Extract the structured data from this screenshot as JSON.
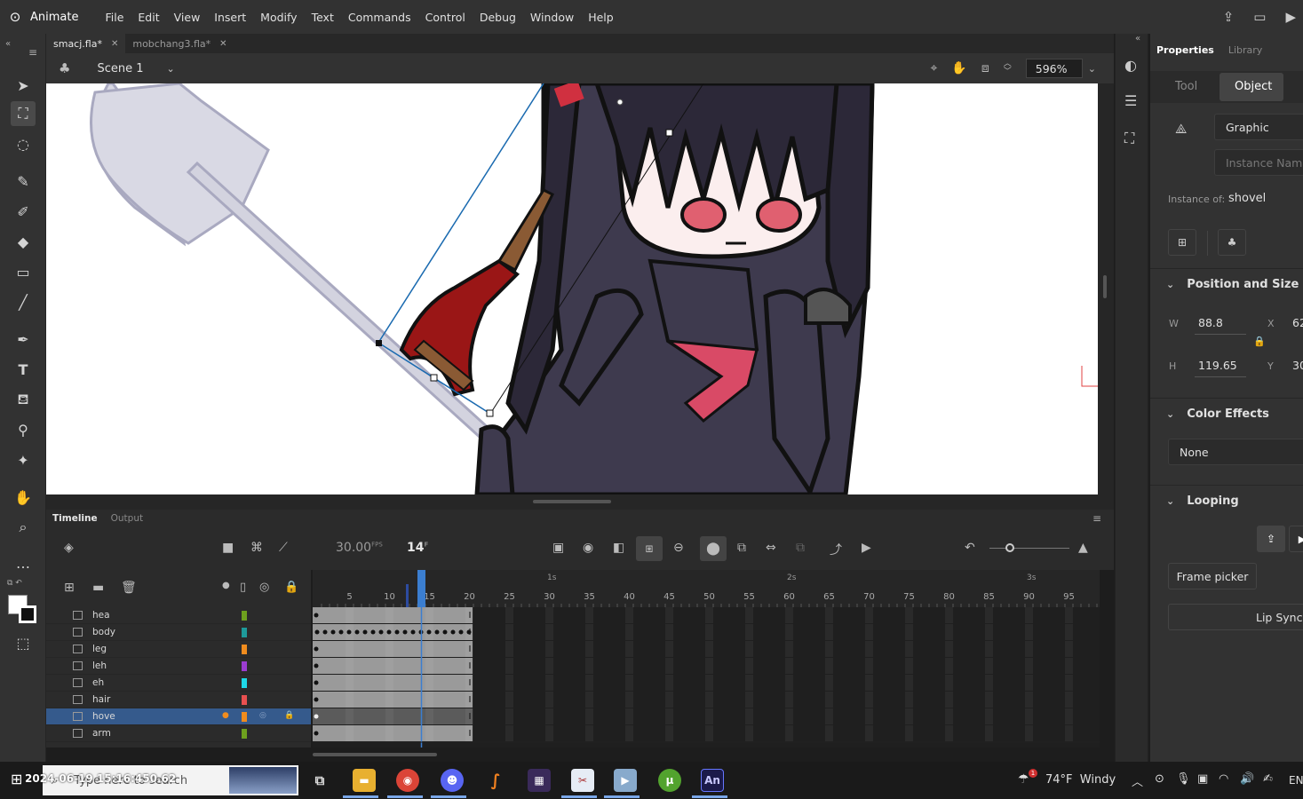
{
  "app": {
    "name": "Animate",
    "logo_glyph": "⚙"
  },
  "menu": [
    "File",
    "Edit",
    "View",
    "Insert",
    "Modify",
    "Text",
    "Commands",
    "Control",
    "Debug",
    "Window",
    "Help"
  ],
  "doc_tabs": [
    {
      "label": "smacj.fla*",
      "active": true
    },
    {
      "label": "mobchang3.fla*",
      "active": false
    }
  ],
  "scene": {
    "label": "Scene 1"
  },
  "zoom": "596%",
  "timeline": {
    "tabs": [
      "Timeline",
      "Output"
    ],
    "fps": "30.00",
    "fps_unit": "FPS",
    "frame": "14",
    "frame_unit": "F",
    "ruler_ticks": [
      "5",
      "10",
      "15",
      "20",
      "25",
      "30",
      "35",
      "40",
      "45",
      "50",
      "55",
      "60",
      "65",
      "70",
      "75",
      "80",
      "85",
      "90",
      "95"
    ],
    "second_markers": [
      "1s",
      "2s",
      "3s"
    ],
    "layers": [
      {
        "name": "hea",
        "color": "#6ea01e",
        "selected": false
      },
      {
        "name": "body",
        "color": "#1e9a9a",
        "selected": false
      },
      {
        "name": "leg",
        "color": "#f08c1e",
        "selected": false
      },
      {
        "name": "leh",
        "color": "#9b3cd0",
        "selected": false
      },
      {
        "name": "eh",
        "color": "#1ed8e8",
        "selected": false
      },
      {
        "name": "hair",
        "color": "#e85050",
        "selected": false
      },
      {
        "name": "hove",
        "color": "#f08c1e",
        "selected": true
      },
      {
        "name": "arm",
        "color": "#6ea01e",
        "selected": false
      }
    ]
  },
  "properties": {
    "tabs": [
      "Properties",
      "Library"
    ],
    "subtabs": [
      "Tool",
      "Object"
    ],
    "symbol_type": "Graphic",
    "instance_name_placeholder": "Instance Name",
    "instance_of_label": "Instance of:",
    "instance_of_value": "shovel",
    "position_size": {
      "title": "Position and Size",
      "w_label": "W",
      "w_value": "88.8",
      "h_label": "H",
      "h_value": "119.65",
      "x_label": "X",
      "x_value": "62",
      "y_label": "Y",
      "y_value": "30"
    },
    "color_effects": {
      "title": "Color Effects",
      "value": "None"
    },
    "looping": {
      "title": "Looping",
      "frame_picker": "Frame picker",
      "lip_sync": "Lip Syncin"
    }
  },
  "taskbar": {
    "search_placeholder": "Type here to search",
    "timestamp_overlay": "2024-06-19 15:16:450.62",
    "weather": "74°F  Windy",
    "lang": "EN",
    "apps": [
      "task-view",
      "file-explorer",
      "chrome",
      "discord",
      "sublime",
      "app-5",
      "app-6",
      "app-7",
      "utorrent",
      "animate"
    ]
  }
}
